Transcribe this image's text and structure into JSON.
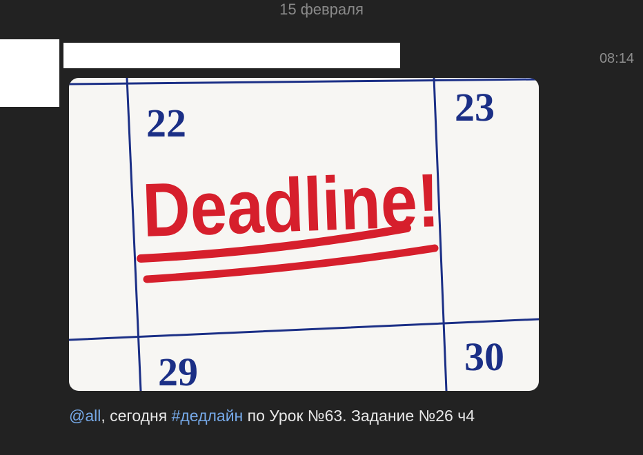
{
  "chat": {
    "date_separator": "15 февраля"
  },
  "message": {
    "time": "08:14",
    "attachment": {
      "calendar_days": [
        "22",
        "23",
        "29",
        "30"
      ],
      "handwritten_text": "Deadline!"
    },
    "text": {
      "mention": "@all",
      "part_after_mention": ", сегодня ",
      "hashtag": "#дедлайн",
      "part_after_hashtag": " по Урок №63. Задание №26 ч4"
    }
  },
  "colors": {
    "background": "#222222",
    "link": "#76a9e8",
    "calendar_ink": "#1b2f86",
    "marker_red": "#d61f2c"
  }
}
